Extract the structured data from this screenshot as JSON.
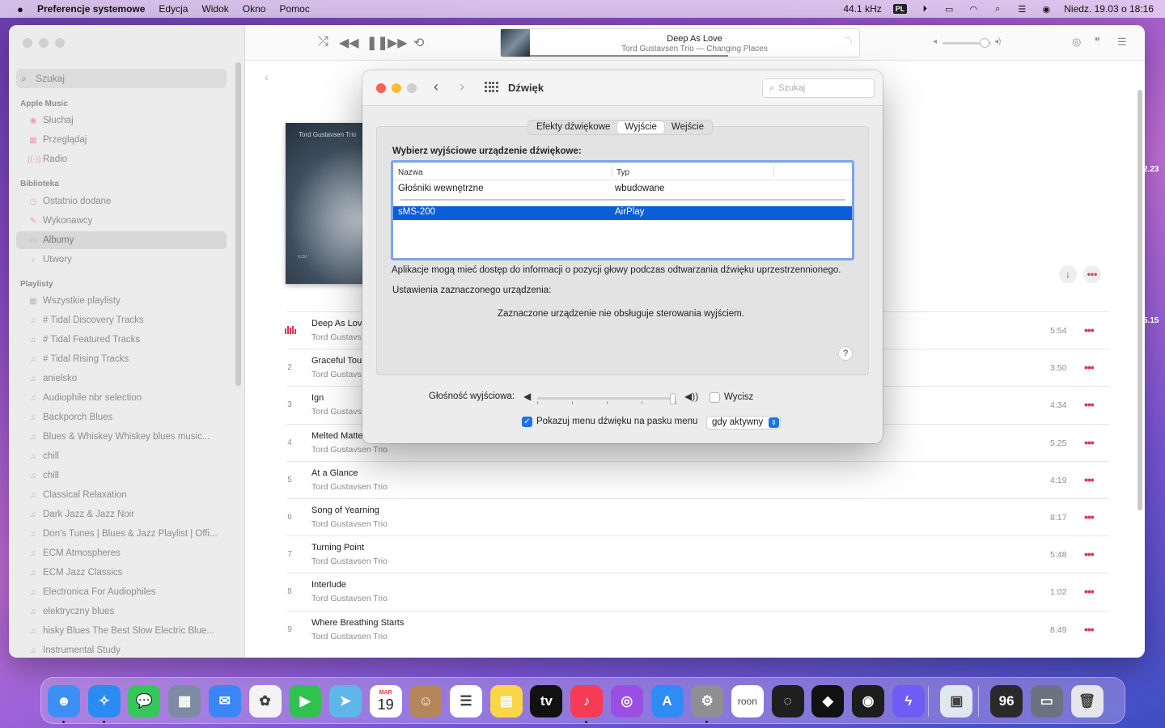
{
  "menubar": {
    "apple_icon": "apple-icon",
    "items": [
      "Preferencje systemowe",
      "Edycja",
      "Widok",
      "Okno",
      "Pomoc"
    ],
    "sample_rate": "44.1 kHz",
    "input_lang": "PL",
    "datetime": "Niedz. 19.03 o 18:16"
  },
  "music": {
    "search_placeholder": "Szukaj",
    "sections": {
      "apple_music": "Apple Music",
      "library": "Biblioteka",
      "playlists": "Playlisty"
    },
    "apple_music_items": [
      "Słuchaj",
      "Przeglądaj",
      "Radio"
    ],
    "library_items": [
      "Ostatnio dodane",
      "Wykonawcy",
      "Albumy",
      "Utwory"
    ],
    "playlists": [
      "Wszystkie playlisty",
      "# Tidal Discovery Tracks",
      "# Tidal Featured Tracks",
      "# Tidal Rising Tracks",
      "anielsko",
      "Audiophile nbr selection",
      "Backporch Blues",
      "Blues & Whiskey  Whiskey blues music...",
      "chill",
      "chill",
      "Classical Relaxation",
      "Dark Jazz & Jazz Noir",
      "Don's Tunes | Blues & Jazz Playlist | Offi...",
      "ECM Atmospheres",
      "ECM Jazz Classics",
      "Electronica For Audiophiles",
      "elektryczny blues",
      "hisky Blues  The Best Slow Electric Blue...",
      "Instrumental Study"
    ],
    "now_playing": {
      "title": "Deep As Love",
      "subtitle": "Tord Gustavsen Trio — Changing Places",
      "progress": 0.6
    },
    "album": {
      "cover_artist": "Tord Gustavsen Trio",
      "label": "ECM"
    },
    "edge_values": [
      "2.23",
      "5.15"
    ],
    "tracks": [
      {
        "num": "1",
        "title": "Deep As Love",
        "artist": "Tord Gustavs",
        "duration": "5:54",
        "playing": true
      },
      {
        "num": "2",
        "title": "Graceful Tou",
        "artist": "Tord Gustavs",
        "duration": "3:50",
        "playing": false
      },
      {
        "num": "3",
        "title": "Ign",
        "artist": "Tord Gustavs",
        "duration": "4:34",
        "playing": false
      },
      {
        "num": "4",
        "title": "Melted Matte",
        "artist": "Tord Gustavsen Trio",
        "duration": "5:25",
        "playing": false
      },
      {
        "num": "5",
        "title": "At a Glance",
        "artist": "Tord Gustavsen Trio",
        "duration": "4:19",
        "playing": false
      },
      {
        "num": "6",
        "title": "Song of Yearning",
        "artist": "Tord Gustavsen Trio",
        "duration": "8:17",
        "playing": false
      },
      {
        "num": "7",
        "title": "Turning Point",
        "artist": "Tord Gustavsen Trio",
        "duration": "5:48",
        "playing": false
      },
      {
        "num": "8",
        "title": "Interlude",
        "artist": "Tord Gustavsen Trio",
        "duration": "1:02",
        "playing": false
      },
      {
        "num": "9",
        "title": "Where Breathing Starts",
        "artist": "Tord Gustavsen Trio",
        "duration": "8:49",
        "playing": false
      }
    ]
  },
  "sound": {
    "title": "Dźwięk",
    "search_placeholder": "Szukaj",
    "tabs": [
      "Efekty dźwiękowe",
      "Wyjście",
      "Wejście"
    ],
    "active_tab": "Wyjście",
    "choose_label": "Wybierz wyjściowe urządzenie dźwiękowe:",
    "columns": [
      "Nazwa",
      "Typ"
    ],
    "devices": [
      {
        "name": "Głośniki wewnętrzne",
        "type": "wbudowane",
        "selected": false
      },
      {
        "name": "sMS-200",
        "type": "AirPlay",
        "selected": true
      }
    ],
    "head_tracking_info": "Aplikacje mogą mieć dostęp do informacji o pozycji głowy podczas odtwarzania dźwięku uprzestrzennionego.",
    "settings_label": "Ustawienia zaznaczonego urządzenia:",
    "not_supported": "Zaznaczone urządzenie nie obsługuje sterowania wyjściem.",
    "help": "?",
    "output_volume_label": "Głośność wyjściowa:",
    "output_volume": 0.97,
    "mute_label": "Wycisz",
    "mute_checked": false,
    "show_menu_label": "Pokazuj menu dźwięku na pasku menu",
    "show_menu_checked": true,
    "show_menu_option": "gdy aktywny"
  },
  "dock": {
    "apps": [
      {
        "name": "Finder",
        "icon": "finder-icon",
        "color": "#3d8ff5",
        "glyph": "☻"
      },
      {
        "name": "Safari",
        "icon": "safari-icon",
        "color": "#2a8cf0",
        "glyph": "✧"
      },
      {
        "name": "Wiadomości",
        "icon": "messages-icon",
        "color": "#35c759",
        "glyph": "💬"
      },
      {
        "name": "Launchpad",
        "icon": "launchpad-icon",
        "color": "#7d8ca3",
        "glyph": "▦"
      },
      {
        "name": "Mail",
        "icon": "mail-icon",
        "color": "#3a86f7",
        "glyph": "✉"
      },
      {
        "name": "Zdjęcia",
        "icon": "photos-icon",
        "color": "#f4f4f4",
        "glyph": "✿"
      },
      {
        "name": "FaceTime",
        "icon": "facetime-icon",
        "color": "#30c24f",
        "glyph": "▶"
      },
      {
        "name": "Mapy",
        "icon": "maps-icon",
        "color": "#5fb6e8",
        "glyph": "➤"
      },
      {
        "name": "Kalendarz",
        "icon": "calendar-icon",
        "color": "#ffffff",
        "glyph": "19",
        "sub": "MAR"
      },
      {
        "name": "Kontakty",
        "icon": "contacts-icon",
        "color": "#b5865a",
        "glyph": "☺"
      },
      {
        "name": "Przypomnienia",
        "icon": "reminders-icon",
        "color": "#ffffff",
        "glyph": "☰"
      },
      {
        "name": "Notatki",
        "icon": "notes-icon",
        "color": "#f9d548",
        "glyph": "▤"
      },
      {
        "name": "Apple TV",
        "icon": "appletv-icon",
        "color": "#111111",
        "glyph": "tv"
      },
      {
        "name": "Muzyka",
        "icon": "music-icon",
        "color": "#f73b55",
        "glyph": "♪"
      },
      {
        "name": "Podcasty",
        "icon": "podcasts-icon",
        "color": "#9b4ee3",
        "glyph": "◎"
      },
      {
        "name": "App Store",
        "icon": "appstore-icon",
        "color": "#2f8cf5",
        "glyph": "A"
      },
      {
        "name": "Preferencje systemowe",
        "icon": "system-preferences-icon",
        "color": "#8e8e93",
        "glyph": "⚙"
      },
      {
        "name": "Roon",
        "icon": "roon-icon",
        "color": "#ffffff",
        "glyph": "roon"
      },
      {
        "name": "Audirvana",
        "icon": "audirvana-icon",
        "color": "#1f1f1f",
        "glyph": "◌"
      },
      {
        "name": "Tidal",
        "icon": "tidal-icon",
        "color": "#111111",
        "glyph": "◆"
      },
      {
        "name": "Spotify",
        "icon": "spotify-icon",
        "color": "#1d1d1d",
        "glyph": "◉"
      },
      {
        "name": "Messenger",
        "icon": "messenger-icon",
        "color": "#6e5cf5",
        "glyph": "ϟ"
      },
      {
        "name": "Podgląd",
        "icon": "preview-icon",
        "color": "#dfe7ef",
        "glyph": "▣"
      },
      {
        "name": "iStat",
        "icon": "istat-icon",
        "color": "#2a2a2a",
        "glyph": "96"
      },
      {
        "name": "Zrzut ekranu",
        "icon": "screenshot-folder-icon",
        "color": "#6b7280",
        "glyph": "▭"
      },
      {
        "name": "Kosz",
        "icon": "trash-icon",
        "color": "#e5e5ea",
        "glyph": "🗑"
      }
    ]
  }
}
